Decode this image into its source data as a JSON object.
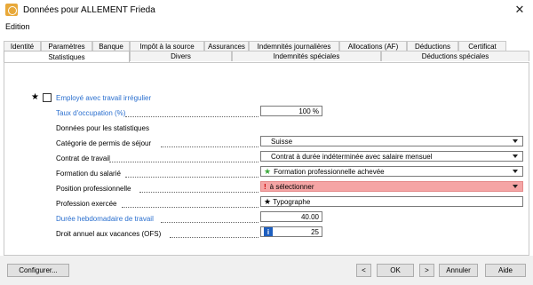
{
  "window": {
    "title": "Données pour ALLEMENT Frieda"
  },
  "menu": {
    "edition": "Edition"
  },
  "tabs_row1": [
    "Identité",
    "Paramètres",
    "Banque",
    "Impôt à la source",
    "Assurances",
    "Indemnités journalières",
    "Allocations (AF)",
    "Déductions",
    "Certificat"
  ],
  "tabs_row2": [
    "Statistiques",
    "Divers",
    "Indemnités spéciales",
    "Déductions spéciales"
  ],
  "form": {
    "irregular_label": "Employé avec travail irrégulier",
    "occupation_label": "Taux d'occupation (%)",
    "occupation_value": "100 %",
    "section_heading": "Données pour les statistiques",
    "permit_label": "Catégorie de permis de séjour",
    "permit_value": "Suisse",
    "contract_label": "Contrat de travail",
    "contract_value": "Contrat à durée indéterminée avec salaire mensuel",
    "education_label": "Formation du salarié",
    "education_value": "Formation professionnelle achevée",
    "position_label": "Position professionnelle",
    "position_value": "à sélectionner",
    "profession_label": "Profession exercée",
    "profession_value": "Typographe",
    "weekly_label": "Durée hebdomadaire de travail",
    "weekly_value": "40.00",
    "vacation_label": "Droit annuel aux vacances (OFS)",
    "vacation_value": "25"
  },
  "buttons": {
    "configure": "Configurer...",
    "prev": "<",
    "ok": "OK",
    "next": ">",
    "cancel": "Annuler",
    "help": "Aide"
  },
  "icons": {
    "app": "app-icon",
    "close": "close-icon",
    "star": "star-icon",
    "info": "info-icon",
    "warning": "warning-icon"
  },
  "colors": {
    "accent_blue": "#2a6fcf",
    "error_pink": "#f5a5a5",
    "green_star": "#3aa83a"
  }
}
